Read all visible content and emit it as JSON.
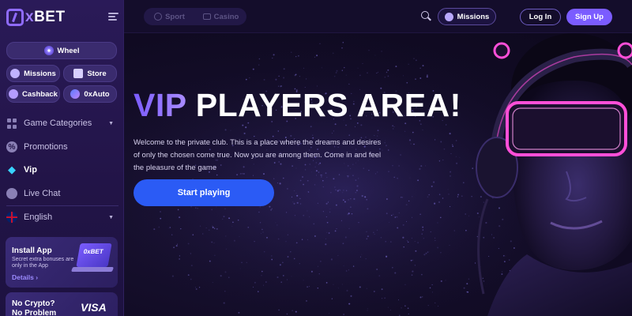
{
  "brand": {
    "prefix": "0",
    "x": "x",
    "name": "BET"
  },
  "sidebar": {
    "wheel_label": "Wheel",
    "missions_label": "Missions",
    "store_label": "Store",
    "cashback_label": "Cashback",
    "auto_label": "0xAuto",
    "nav": [
      {
        "label": "Game Categories"
      },
      {
        "label": "Promotions"
      },
      {
        "label": "Vip"
      },
      {
        "label": "Live Chat"
      },
      {
        "label": "English"
      }
    ],
    "install": {
      "title": "Install App",
      "subtitle": "Secret extra bonuses are only in the App",
      "link": "Details",
      "screen_text": "0xBET"
    },
    "crypto": {
      "title_line1": "No Crypto?",
      "title_line2": "No Problem",
      "visa": "VISA"
    }
  },
  "header": {
    "sport_label": "Sport",
    "casino_label": "Casino",
    "missions_label": "Missions",
    "login_label": "Log In",
    "signup_label": "Sign Up"
  },
  "hero": {
    "title_vip": "VIP",
    "title_rest": " PLAYERS AREA!",
    "description": "Welcome to the private club. This is a place where the dreams and desires of only the chosen come true. Now you are among them. Come in and feel the pleasure of the game",
    "cta_label": "Start playing"
  },
  "colors": {
    "accent": "#7b5cff",
    "cta": "#2b5bf5",
    "neon": "#ff4fd8"
  }
}
